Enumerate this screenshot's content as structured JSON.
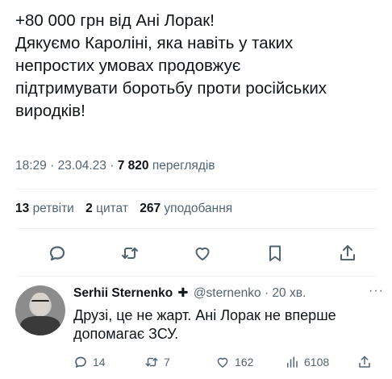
{
  "tweet": {
    "text_lines": [
      "+80 000 грн від Ані Лорак!",
      "Дякуємо Кароліні, яка навіть у таких",
      "непростих умовах продовжує",
      "підтримувати боротьбу проти російських",
      "виродків!"
    ],
    "time": "18:29",
    "date": "23.04.23",
    "views_count": "7 820",
    "views_label": "переглядів",
    "retweets_count": "13",
    "retweets_label": "ретвіти",
    "quotes_count": "2",
    "quotes_label": "цитат",
    "likes_count": "267",
    "likes_label": "уподобання"
  },
  "actions": {
    "icons": [
      "reply-icon",
      "retweet-icon",
      "like-icon",
      "bookmark-icon",
      "share-icon"
    ]
  },
  "reply": {
    "author_name": "Serhii Sternenko",
    "author_badge": "✚",
    "handle": "@sternenko",
    "time_ago": "20 хв.",
    "more": "···",
    "text_lines": [
      "Друзі, це не жарт. Ані Лорак не вперше",
      "допомагає ЗСУ."
    ],
    "replies_count": "14",
    "retweets_count": "7",
    "likes_count": "162",
    "views_count": "6108"
  },
  "colors": {
    "text": "#0f1419",
    "secondary": "#536471",
    "divider": "#eff3f4"
  }
}
